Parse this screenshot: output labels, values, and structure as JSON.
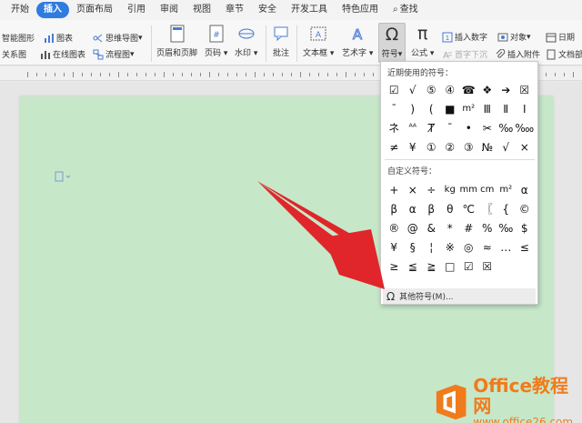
{
  "menu_tabs": [
    "开始",
    "插入",
    "页面布局",
    "引用",
    "审阅",
    "视图",
    "章节",
    "安全",
    "开发工具",
    "特色应用"
  ],
  "active_tab": "插入",
  "search_label": "查找",
  "ribbon": {
    "smart_graphic": "智能图形",
    "chart": "图表",
    "mind_map": "思维导图",
    "relation": "关系图",
    "online_chart": "在线图表",
    "flowchart": "流程图",
    "header_footer": "页眉和页脚",
    "page_number": "页码",
    "watermark": "水印",
    "comment": "批注",
    "textbox": "文本框",
    "art_text": "艺术字",
    "symbol": "符号",
    "formula": "公式",
    "insert_number": "插入数字",
    "object": "对象",
    "drop_cap": "首字下沉",
    "insert_attachment": "插入附件",
    "date": "日期",
    "doc_part": "文档部"
  },
  "icons": {
    "symbol": "omega-icon",
    "formula": "pi-icon"
  },
  "dropdown": {
    "recent_title": "近期使用的符号：",
    "recent_symbols": [
      "☑",
      "√",
      "⑤",
      "④",
      "☎",
      "❖",
      "➔",
      "☒",
      "¯",
      ")",
      "(",
      "■",
      "m²",
      "Ⅲ",
      "Ⅱ",
      "Ⅰ",
      "ネ",
      "ᴬᴬ",
      "Ⱦ",
      "ˉ",
      "•",
      "✂",
      "‰",
      "‱",
      "≠",
      "¥",
      "①",
      "②",
      "③",
      "№",
      "√",
      "×"
    ],
    "custom_title": "自定义符号：",
    "custom_symbols": [
      "+",
      "×",
      "÷",
      "kg",
      "mm",
      "cm",
      "m²",
      "α",
      "β",
      "α",
      "β",
      "θ",
      "℃",
      "〖",
      "{",
      "©",
      "®",
      "@",
      "&",
      "*",
      "#",
      "%",
      "‰",
      "$",
      "¥",
      "§",
      "¦",
      "※",
      "◎",
      "≈",
      "…",
      "≤",
      "≥",
      "≦",
      "≧",
      "□",
      "☑",
      "☒"
    ],
    "more_label": "其他符号(M)..."
  },
  "watermark_site": {
    "line1": "Office教程网",
    "line2": "www.office26.com"
  },
  "colors": {
    "accent": "#2f7be0",
    "page_bg": "#c6e8c9",
    "arrow": "#e0262b",
    "watermark": "#f07b1d"
  }
}
